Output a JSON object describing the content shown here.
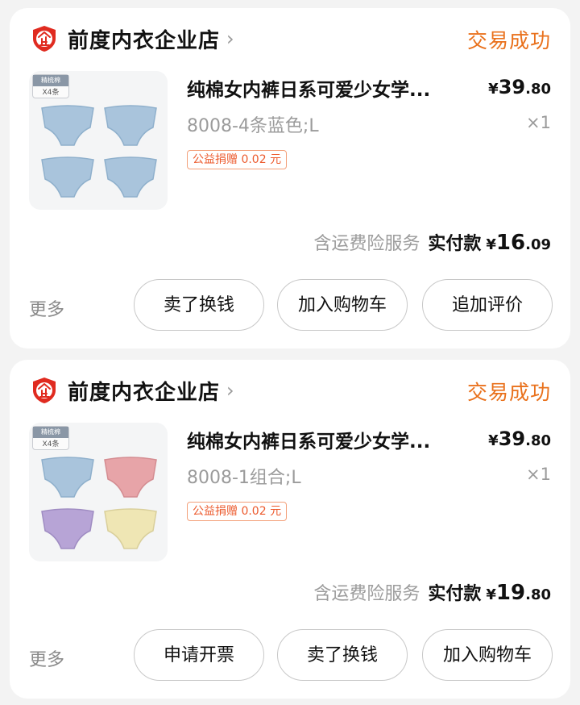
{
  "orders": [
    {
      "shop_name": "前度内衣企业店",
      "status": "交易成功",
      "product": {
        "title": "纯棉女内裤日系可爱少女学...",
        "price_symbol": "¥",
        "price_integer": "39",
        "price_decimal": ".80",
        "sku": "8008-4条蓝色;L",
        "quantity": "×1",
        "charity_tag": "公益捐赠 0.02 元",
        "image_tag_top": "精梳棉",
        "image_tag_bottom": "X4条",
        "garment_colors": [
          "#a9c4dc",
          "#a9c4dc",
          "#a9c4dc",
          "#a9c4dc"
        ]
      },
      "service_note": "含运费险服务",
      "paid_label": "实付款",
      "paid_symbol": "¥",
      "paid_integer": "16",
      "paid_decimal": ".09",
      "more_label": "更多",
      "actions": [
        "卖了换钱",
        "加入购物车",
        "追加评价"
      ]
    },
    {
      "shop_name": "前度内衣企业店",
      "status": "交易成功",
      "product": {
        "title": "纯棉女内裤日系可爱少女学...",
        "price_symbol": "¥",
        "price_integer": "39",
        "price_decimal": ".80",
        "sku": "8008-1组合;L",
        "quantity": "×1",
        "charity_tag": "公益捐赠 0.02 元",
        "image_tag_top": "精梳棉",
        "image_tag_bottom": "X4条",
        "garment_colors": [
          "#a9c4dc",
          "#e7a4a8",
          "#b7a4d6",
          "#efe6b4"
        ]
      },
      "service_note": "含运费险服务",
      "paid_label": "实付款",
      "paid_symbol": "¥",
      "paid_integer": "19",
      "paid_decimal": ".80",
      "more_label": "更多",
      "actions": [
        "申请开票",
        "卖了换钱",
        "加入购物车"
      ]
    }
  ],
  "colors": {
    "status_orange": "#e9711c",
    "badge_red": "#e02b20",
    "charity_orange": "#ec5a2d"
  },
  "icons": {
    "shop_badge": "enterprise-shield-icon",
    "chevron": "chevron-right-icon"
  }
}
